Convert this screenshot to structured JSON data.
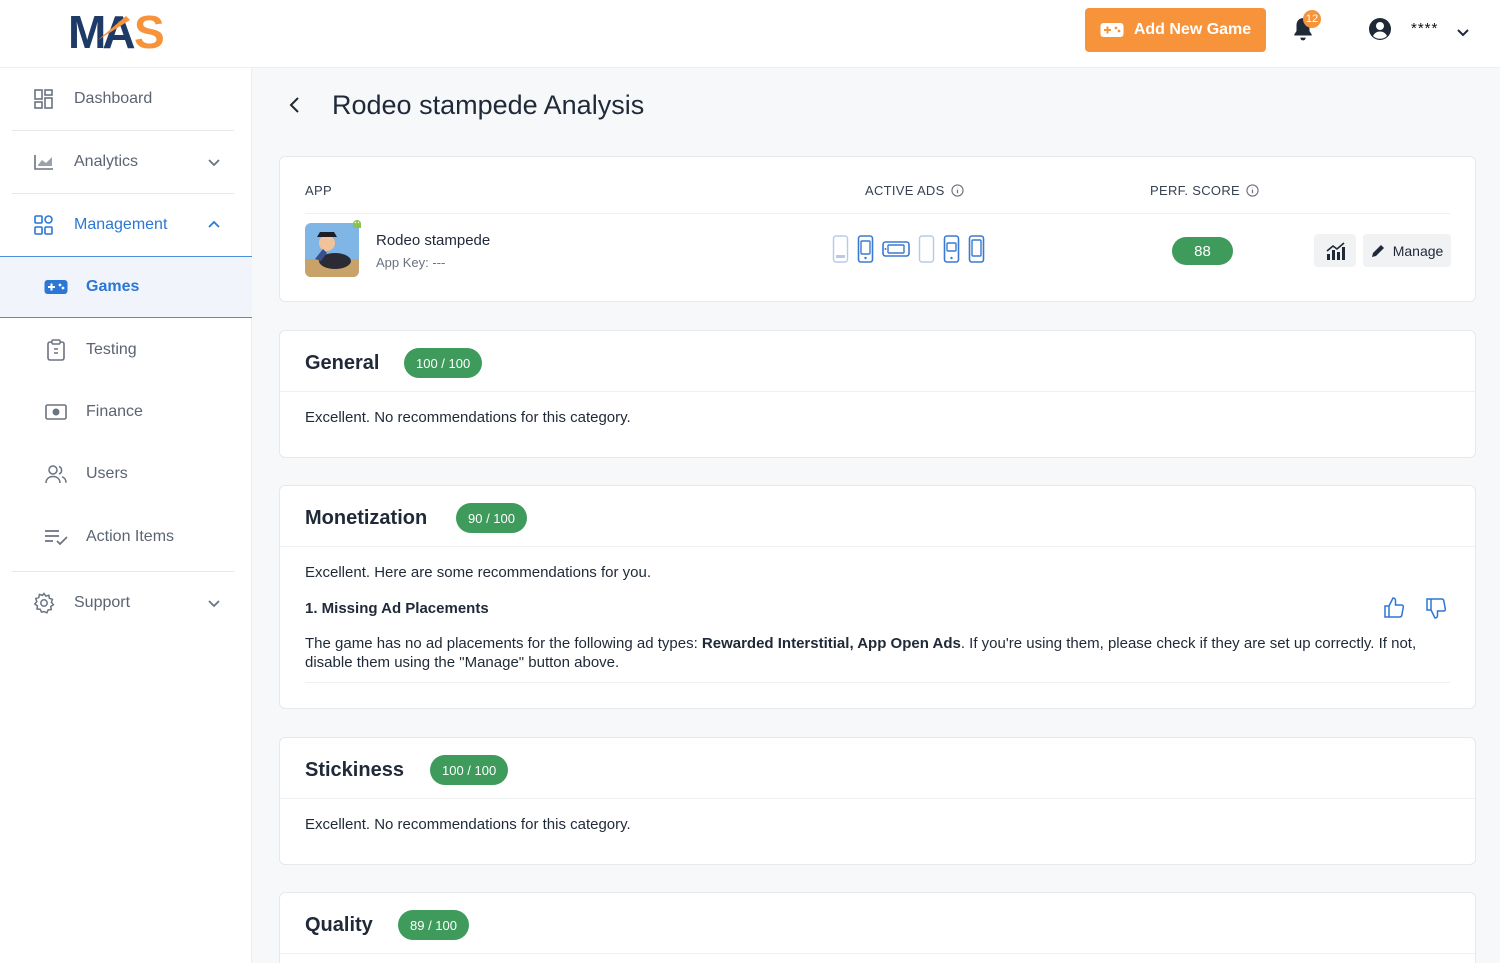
{
  "brand": {
    "logo_text": "MAS",
    "accent": "#f7943b",
    "link_blue": "#2a77d4",
    "score_green": "#3e9b5c"
  },
  "topbar": {
    "add_game_label": "Add New Game",
    "notification_count": "12",
    "user_name": "****"
  },
  "sidebar": {
    "dashboard": "Dashboard",
    "analytics": "Analytics",
    "management": "Management",
    "games": "Games",
    "testing": "Testing",
    "finance": "Finance",
    "users": "Users",
    "action_items": "Action Items",
    "support": "Support"
  },
  "page": {
    "title": "Rodeo stampede Analysis"
  },
  "app_table": {
    "col_app": "APP",
    "col_active_ads": "ACTIVE ADS",
    "col_perf_score": "PERF. SCORE",
    "app_name": "Rodeo stampede",
    "app_key": "App Key: ---",
    "perf_score": "88",
    "manage_label": "Manage",
    "ad_icons": [
      "banner-icon",
      "interstitial-icon",
      "rewarded-icon",
      "native-icon",
      "mrec-icon",
      "app-open-icon"
    ]
  },
  "categories": {
    "general": {
      "title": "General",
      "score": "100 / 100",
      "summary": "Excellent. No recommendations for this category."
    },
    "monetization": {
      "title": "Monetization",
      "score": "90 / 100",
      "summary": "Excellent. Here are some recommendations for you.",
      "rec_title": "1. Missing Ad Placements",
      "rec_body_prefix": "The game has no ad placements for the following ad types: ",
      "rec_body_bold": "Rewarded Interstitial, App Open Ads",
      "rec_body_suffix": ". If you're using them, please check if they are set up correctly. If not, disable them using the \"Manage\" button above."
    },
    "stickiness": {
      "title": "Stickiness",
      "score": "100 / 100",
      "summary": "Excellent. No recommendations for this category."
    },
    "quality": {
      "title": "Quality",
      "score": "89 / 100"
    }
  }
}
